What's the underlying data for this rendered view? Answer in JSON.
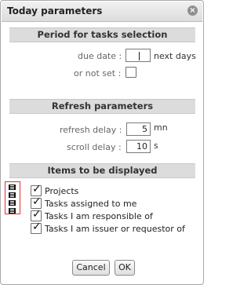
{
  "dialog": {
    "title": "Today parameters"
  },
  "sections": {
    "period": {
      "header": "Period for tasks selection",
      "due_date_label": "due date :",
      "due_date_value": "",
      "due_date_unit": "next days",
      "not_set_label": "or not set :",
      "not_set_checked": false
    },
    "refresh": {
      "header": "Refresh parameters",
      "refresh_label": "refresh delay :",
      "refresh_value": "5",
      "refresh_unit": "mn",
      "scroll_label": "scroll delay :",
      "scroll_value": "10",
      "scroll_unit": "s"
    },
    "items": {
      "header": "Items to be displayed",
      "list": [
        {
          "label": "Projects",
          "checked": true
        },
        {
          "label": "Tasks assigned to me",
          "checked": true
        },
        {
          "label": "Tasks I am responsible of",
          "checked": true
        },
        {
          "label": "Tasks I am issuer or requestor of",
          "checked": true
        }
      ]
    }
  },
  "buttons": {
    "cancel": "Cancel",
    "ok": "OK"
  },
  "icons": {
    "close": "close-icon",
    "drag": "drag-handle-icon"
  },
  "colors": {
    "handle_border": "#e23030",
    "section_bg": "#dcdcdc"
  }
}
